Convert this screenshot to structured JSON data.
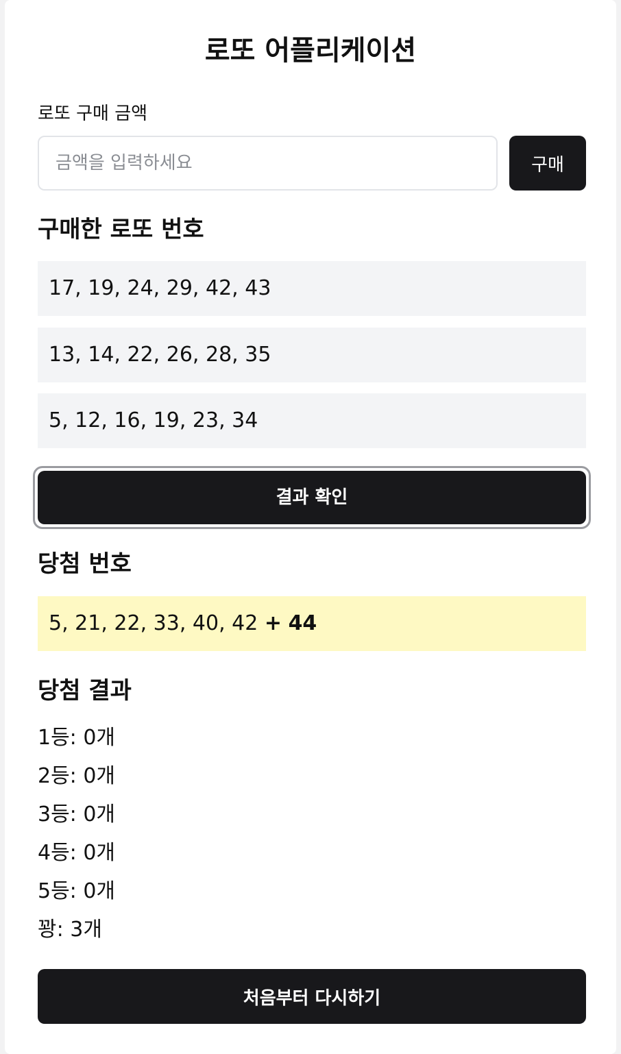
{
  "app": {
    "title": "로또 어플리케이션"
  },
  "purchase": {
    "label": "로또 구매 금액",
    "placeholder": "금액을 입력하세요",
    "value": "",
    "buy_label": "구매"
  },
  "tickets": {
    "heading": "구매한 로또 번호",
    "items": [
      "17, 19, 24, 29, 42, 43",
      "13, 14, 22, 26, 28, 35",
      "5, 12, 16, 19, 23, 34"
    ]
  },
  "check_button_label": "결과 확인",
  "winning": {
    "heading": "당첨 번호",
    "numbers": "5, 21, 22, 33, 40, 42",
    "separator": "+",
    "bonus": "44"
  },
  "results": {
    "heading": "당첨 결과",
    "lines": [
      "1등: 0개",
      "2등: 0개",
      "3등: 0개",
      "4등: 0개",
      "5등: 0개",
      "꽝: 3개"
    ]
  },
  "restart_label": "처음부터 다시하기",
  "colors": {
    "primary": "#18181b",
    "ticket_bg": "#f3f4f6",
    "winning_bg": "#fef9c3",
    "input_border": "#e2e4e8"
  }
}
